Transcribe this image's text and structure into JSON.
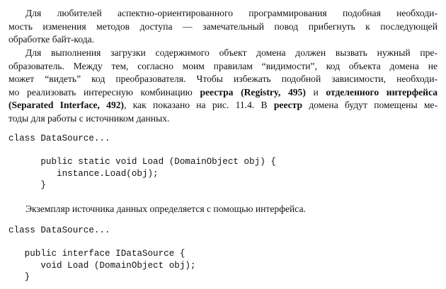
{
  "paragraphs": {
    "p1": {
      "l1": "Для любителей аспектно-ориентированного программирования подобная необходи-",
      "l2": "мость изменения методов доступа — замечательный повод прибегнуть к последующей",
      "l3": "обработке байт-кода."
    },
    "p2": {
      "l1": "Для выполнения загрузки содержимого объект домена должен вызвать нужный пре-",
      "l2": "образователь. Между тем, согласно моим правилам “видимости”, код объекта домена не",
      "l3": "может “видеть” код преобразователя. Чтобы избежать подобной зависимости, необходи-",
      "l4a": "мо реализовать интересную комбинацию ",
      "l4b": "реестра (Registry, 495)",
      "l4c": " и ",
      "l4d": "отделенного интерфейса",
      "l5a": "(Separated Interface, 492)",
      "l5b": ", как показано на рис. 11.4. В ",
      "l5c": "реестр",
      "l5d": " домена будут помещены ме-",
      "l6": "тоды для работы с источником данных."
    },
    "p3": {
      "l1": "Экземпляр источника данных определяется с помощью интерфейса."
    }
  },
  "code1": {
    "l1": "class DataSource...",
    "l2": "      public static void Load (DomainObject obj) {",
    "l3": "         instance.Load(obj);",
    "l4": "      }"
  },
  "code2": {
    "l1": "class DataSource...",
    "l2": "   public interface IDataSource {",
    "l3": "      void Load (DomainObject obj);",
    "l4": "   }"
  }
}
